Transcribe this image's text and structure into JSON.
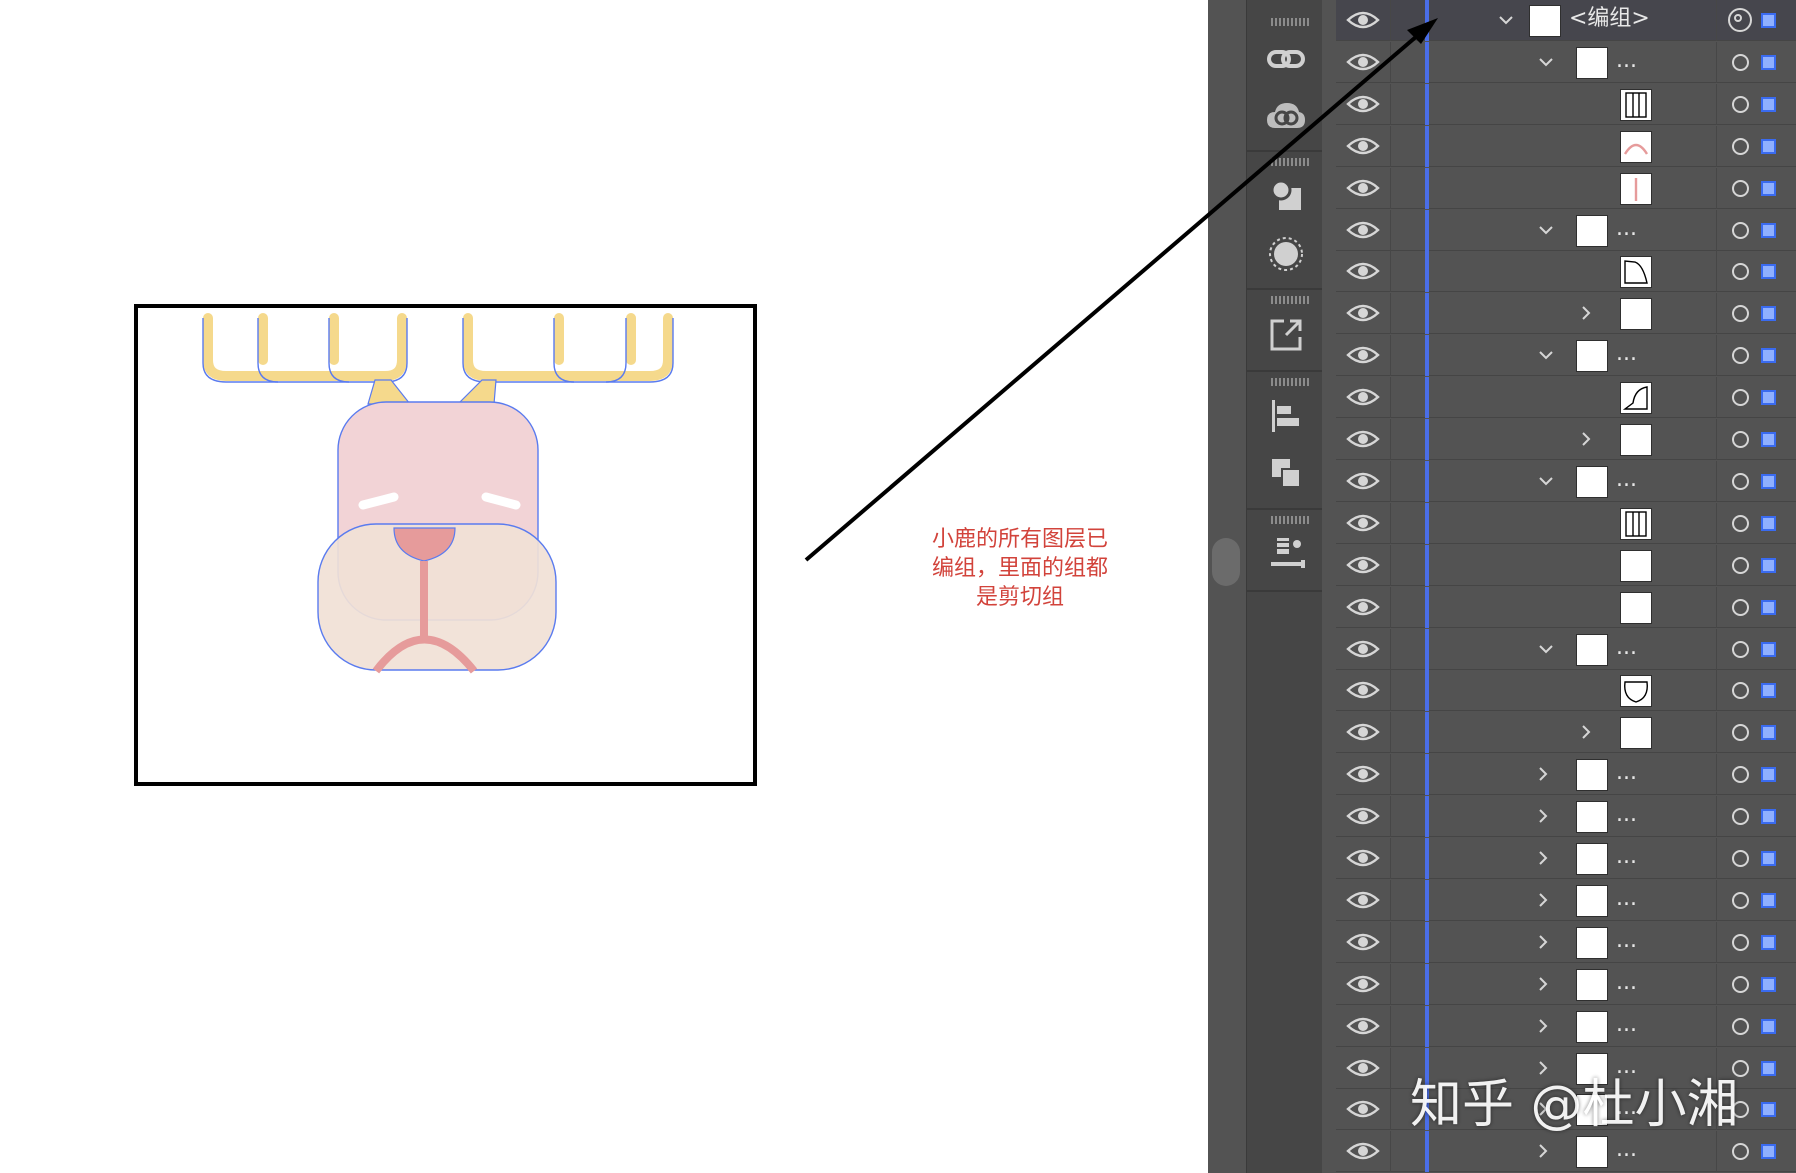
{
  "annotation": {
    "lines": [
      "小鹿的所有图层已",
      "编组，里面的组都",
      "是剪切组"
    ],
    "color": "#d2433b"
  },
  "colors": {
    "layer_color": "#4a6ee8",
    "antler": "#f5d98c",
    "head": "#f2d3d6",
    "muzzle": "#f1e1d6",
    "nose": "#e69b9b",
    "path_outline": "#5a7bef"
  },
  "toolbar": {
    "tools": [
      {
        "icon": "links-icon"
      },
      {
        "icon": "creative-cloud-libraries-icon"
      },
      {
        "icon": "shapes-icon"
      },
      {
        "icon": "appearance-icon"
      },
      {
        "icon": "export-icon"
      },
      {
        "icon": "align-icon"
      },
      {
        "icon": "pathfinder-icon"
      },
      {
        "icon": "asset-export-icon"
      }
    ]
  },
  "layers": {
    "rows": [
      {
        "label": "<编组>",
        "expand": "open",
        "thumb": "blank",
        "selected": true,
        "target": "double"
      },
      {
        "label": "...",
        "expand": "open",
        "thumb": "blank"
      },
      {
        "label": "",
        "expand": "none",
        "thumb": "bars"
      },
      {
        "label": "",
        "expand": "none",
        "thumb": "arc"
      },
      {
        "label": "",
        "expand": "none",
        "thumb": "line"
      },
      {
        "label": "...",
        "expand": "open",
        "thumb": "blank"
      },
      {
        "label": "",
        "expand": "none",
        "thumb": "curve-a"
      },
      {
        "label": "",
        "expand": "closed-inner",
        "thumb": "blank"
      },
      {
        "label": "...",
        "expand": "open",
        "thumb": "blank"
      },
      {
        "label": "",
        "expand": "none",
        "thumb": "curve-b"
      },
      {
        "label": "",
        "expand": "closed-inner",
        "thumb": "blank"
      },
      {
        "label": "...",
        "expand": "open",
        "thumb": "blank"
      },
      {
        "label": "",
        "expand": "none",
        "thumb": "bars"
      },
      {
        "label": "",
        "expand": "none",
        "thumb": "blank"
      },
      {
        "label": "",
        "expand": "none",
        "thumb": "blank"
      },
      {
        "label": "...",
        "expand": "open",
        "thumb": "blank"
      },
      {
        "label": "",
        "expand": "none",
        "thumb": "head"
      },
      {
        "label": "",
        "expand": "closed-inner",
        "thumb": "blank"
      },
      {
        "label": "...",
        "expand": "closed",
        "thumb": "blank"
      },
      {
        "label": "...",
        "expand": "closed",
        "thumb": "blank"
      },
      {
        "label": "...",
        "expand": "closed",
        "thumb": "blank"
      },
      {
        "label": "...",
        "expand": "closed",
        "thumb": "blank"
      },
      {
        "label": "...",
        "expand": "closed",
        "thumb": "blank"
      },
      {
        "label": "...",
        "expand": "closed",
        "thumb": "blank"
      },
      {
        "label": "...",
        "expand": "closed",
        "thumb": "blank"
      },
      {
        "label": "...",
        "expand": "closed",
        "thumb": "blank"
      },
      {
        "label": "...",
        "expand": "closed",
        "thumb": "blank"
      },
      {
        "label": "...",
        "expand": "closed",
        "thumb": "blank"
      }
    ]
  },
  "watermark": "知乎 @杜小湘"
}
